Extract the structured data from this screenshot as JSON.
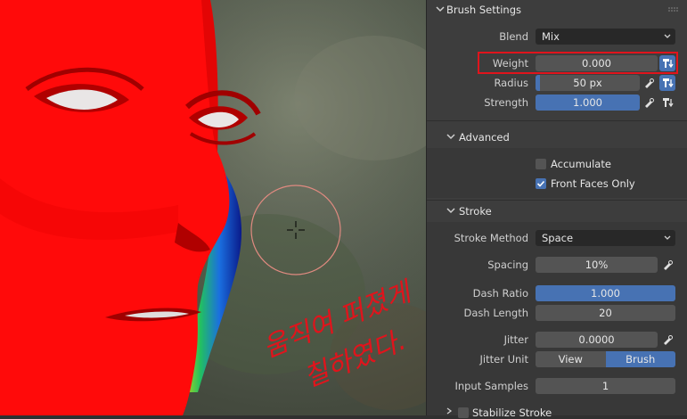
{
  "panel": {
    "brush_settings": {
      "title": "Brush Settings",
      "blend_label": "Blend",
      "blend_value": "Mix",
      "weight_label": "Weight",
      "weight_value": "0.000",
      "radius_label": "Radius",
      "radius_value": "50 px",
      "radius_fill": 0.04,
      "strength_label": "Strength",
      "strength_value": "1.000",
      "strength_fill": 1.0
    },
    "advanced": {
      "title": "Advanced",
      "accumulate_label": "Accumulate",
      "accumulate_checked": false,
      "front_faces_label": "Front Faces Only",
      "front_faces_checked": true
    },
    "stroke": {
      "title": "Stroke",
      "method_label": "Stroke Method",
      "method_value": "Space",
      "spacing_label": "Spacing",
      "spacing_value": "10%",
      "dash_ratio_label": "Dash Ratio",
      "dash_ratio_value": "1.000",
      "dash_length_label": "Dash Length",
      "dash_length_value": "20",
      "jitter_label": "Jitter",
      "jitter_value": "0.0000",
      "jitter_unit_label": "Jitter Unit",
      "jitter_unit_options": [
        "View",
        "Brush"
      ],
      "jitter_unit_selected": "Brush",
      "input_samples_label": "Input Samples",
      "input_samples_value": "1",
      "stabilize_label": "Stabilize Stroke"
    }
  },
  "viewport": {
    "handwritten_line1": "움직여 퍼졌게",
    "handwritten_line2": "칠하였다.",
    "face_color": "#ff0a0a",
    "cursor_circle_color": "#e08a80",
    "annotation_color": "#e0141c"
  },
  "colors": {
    "accent": "#4772b3",
    "highlight_box": "#e0141c"
  }
}
